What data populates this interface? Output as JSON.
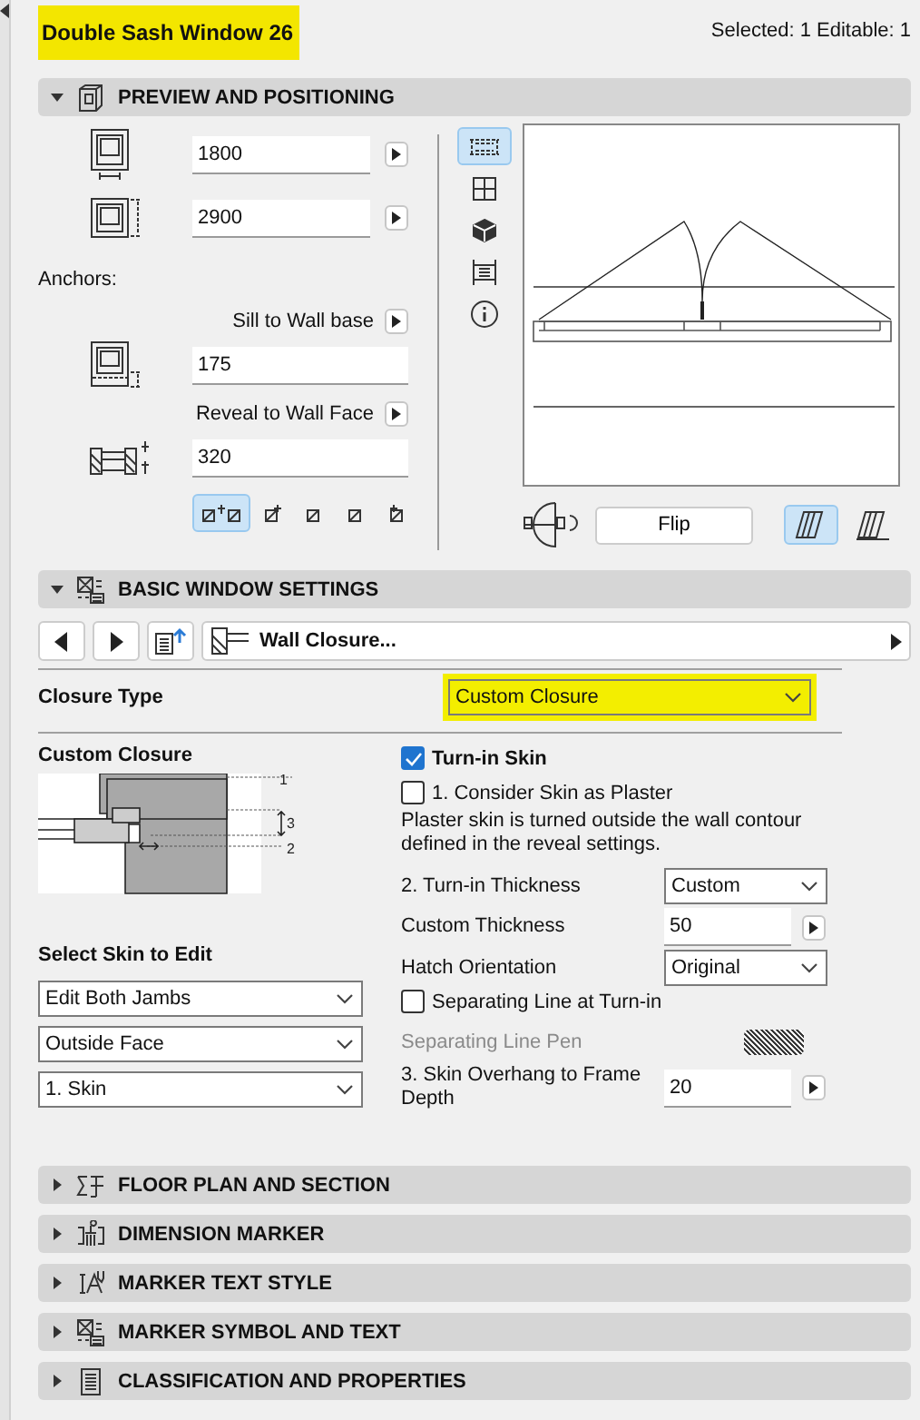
{
  "header": {
    "title": "Double Sash Window 26",
    "title_highlighted": true,
    "status": "Selected: 1 Editable: 1"
  },
  "preview_section": {
    "title": "PREVIEW AND POSITIONING",
    "expanded": true,
    "width_value": "1800",
    "height_value": "2900",
    "anchors_label": "Anchors:",
    "sill_label": "Sill to Wall base",
    "sill_value": "175",
    "reveal_label": "Reveal to Wall Face",
    "reveal_value": "320",
    "anchor_options": [
      {
        "selected": true
      },
      {
        "selected": false
      },
      {
        "selected": false
      },
      {
        "selected": false
      },
      {
        "selected": false
      }
    ],
    "view_modes": [
      {
        "selected": true
      },
      {
        "selected": false
      },
      {
        "selected": false
      },
      {
        "selected": false
      },
      {
        "selected": false
      }
    ],
    "flip_button": "Flip",
    "display_modes": [
      {
        "selected": true
      },
      {
        "selected": false
      }
    ]
  },
  "basic_section": {
    "title": "BASIC WINDOW SETTINGS",
    "expanded": true,
    "page": "Wall Closure...",
    "closure_type_label": "Closure Type",
    "closure_type": "Custom Closure",
    "closure_type_highlighted": true,
    "diagram_title": "Custom Closure",
    "diagram_callouts": [
      "1",
      "3",
      "2"
    ],
    "skin_label": "Select Skin to Edit",
    "skin_selects": [
      "Edit Both Jambs",
      "Outside Face",
      "1. Skin"
    ],
    "options": [
      {
        "kind": "heading_checkbox",
        "label": "Turn-in Skin",
        "checked": true
      },
      {
        "kind": "checkbox",
        "label": "1. Consider Skin as Plaster",
        "checked": false
      },
      {
        "kind": "note",
        "text": "Plaster skin is turned outside the wall contour defined in the reveal settings."
      },
      {
        "kind": "select",
        "label": "2. Turn-in Thickness",
        "value": "Custom"
      },
      {
        "kind": "number",
        "label": "Custom Thickness",
        "value": "50"
      },
      {
        "kind": "select",
        "label": "Hatch Orientation",
        "value": "Original"
      },
      {
        "kind": "checkbox",
        "label": "Separating Line at Turn-in",
        "checked": false
      },
      {
        "kind": "pen",
        "label": "Separating Line Pen",
        "disabled": true
      },
      {
        "kind": "number",
        "label": "3. Skin Overhang to Frame Depth",
        "value": "20"
      }
    ]
  },
  "collapsed_sections": [
    {
      "title": "FLOOR PLAN AND SECTION",
      "expanded": false
    },
    {
      "title": "DIMENSION MARKER",
      "expanded": false
    },
    {
      "title": "MARKER TEXT STYLE",
      "expanded": false
    },
    {
      "title": "MARKER SYMBOL AND TEXT",
      "expanded": false
    },
    {
      "title": "CLASSIFICATION AND PROPERTIES",
      "expanded": false
    }
  ]
}
